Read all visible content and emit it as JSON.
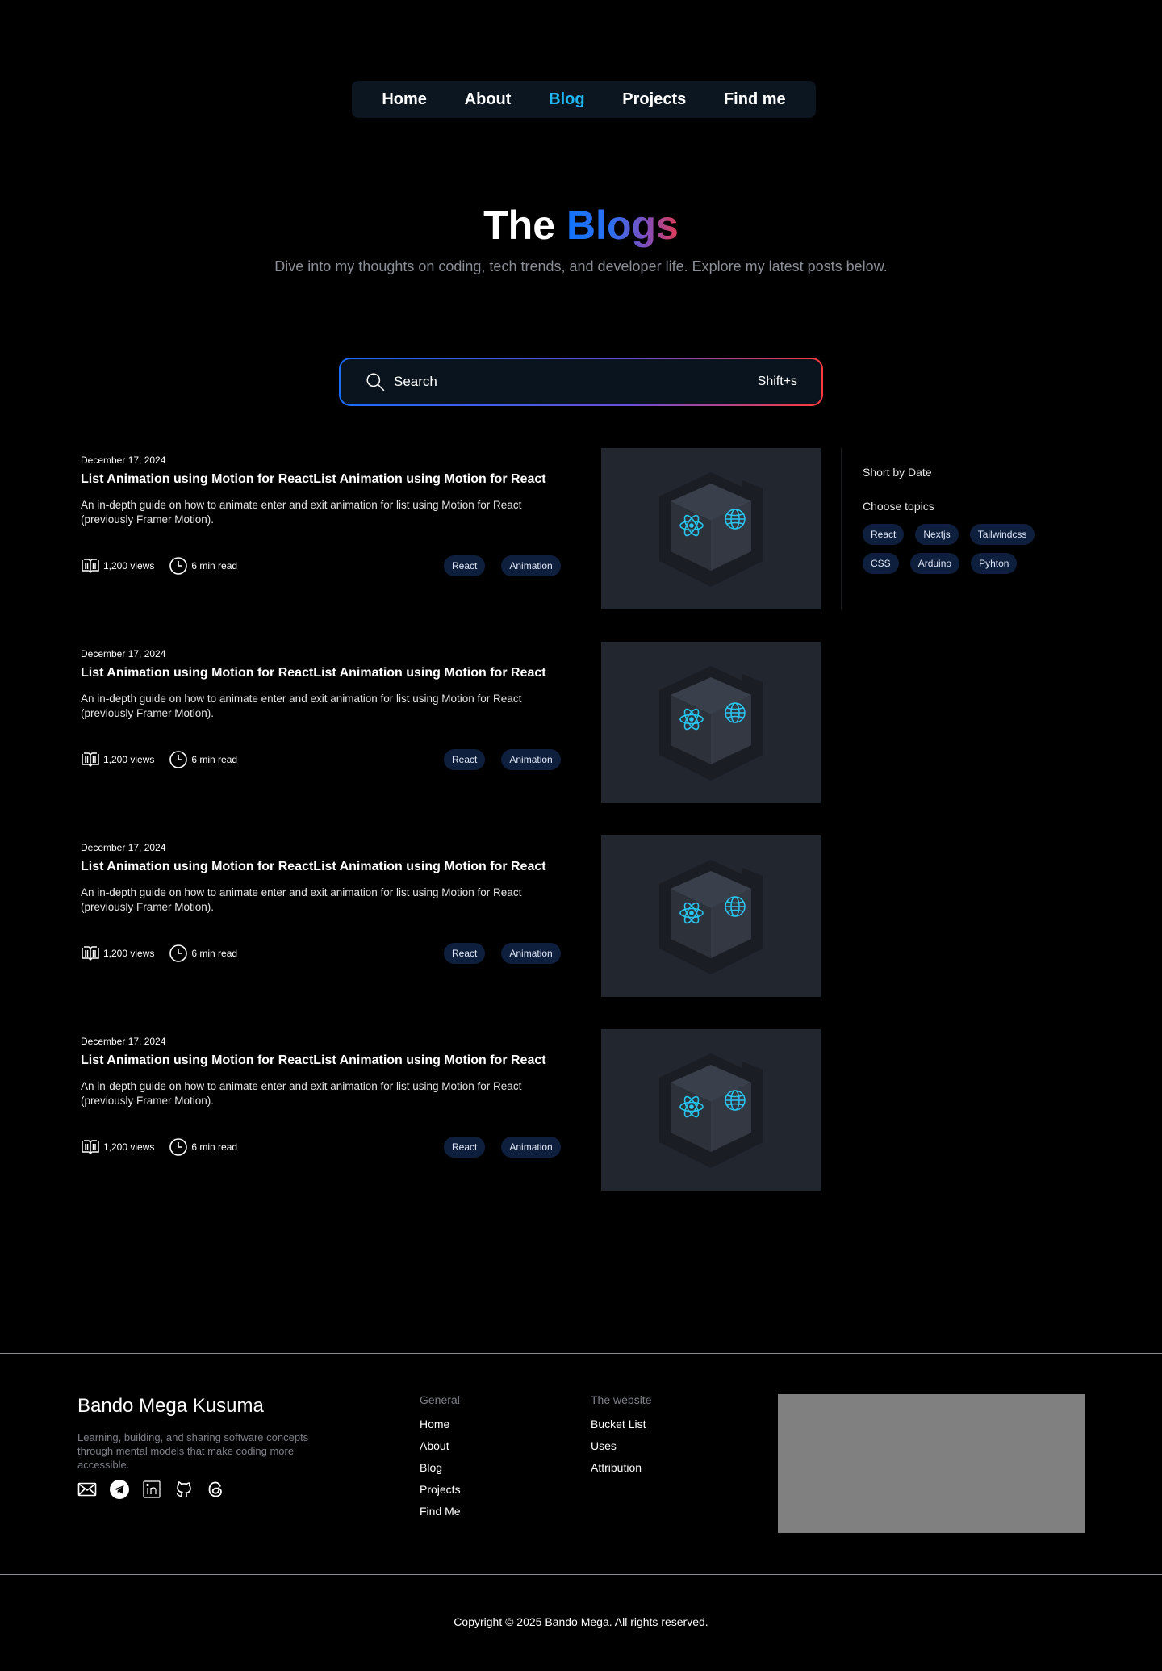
{
  "nav": {
    "items": [
      {
        "label": "Home",
        "active": false
      },
      {
        "label": "About",
        "active": false
      },
      {
        "label": "Blog",
        "active": true
      },
      {
        "label": "Projects",
        "active": false
      },
      {
        "label": "Find me",
        "active": false
      }
    ]
  },
  "hero": {
    "title_plain": "The",
    "title_gradient": "Blogs",
    "subtitle": "Dive into my thoughts on coding, tech trends, and developer life. Explore my latest posts below."
  },
  "search": {
    "placeholder": "Search",
    "shortcut": "Shift+s"
  },
  "posts": [
    {
      "date": "December 17, 2024",
      "title": "List Animation using Motion for ReactList Animation using Motion for React",
      "description": "An in-depth guide on how to animate enter and exit animation for list using Motion for React (previously Framer Motion).",
      "views": "1,200 views",
      "read_time": "6 min read",
      "tags": [
        "React",
        "Animation"
      ]
    },
    {
      "date": "December 17, 2024",
      "title": "List Animation using Motion for ReactList Animation using Motion for React",
      "description": "An in-depth guide on how to animate enter and exit animation for list using Motion for React (previously Framer Motion).",
      "views": "1,200 views",
      "read_time": "6 min read",
      "tags": [
        "React",
        "Animation"
      ]
    },
    {
      "date": "December 17, 2024",
      "title": "List Animation using Motion for ReactList Animation using Motion for React",
      "description": "An in-depth guide on how to animate enter and exit animation for list using Motion for React (previously Framer Motion).",
      "views": "1,200 views",
      "read_time": "6 min read",
      "tags": [
        "React",
        "Animation"
      ]
    },
    {
      "date": "December 17, 2024",
      "title": "List Animation using Motion for ReactList Animation using Motion for React",
      "description": "An in-depth guide on how to animate enter and exit animation for list using Motion for React (previously Framer Motion).",
      "views": "1,200 views",
      "read_time": "6 min read",
      "tags": [
        "React",
        "Animation"
      ]
    }
  ],
  "sidebar": {
    "sort_label": "Short by Date",
    "topics_label": "Choose topics",
    "topics": [
      "React",
      "Nextjs",
      "Tailwindcss",
      "CSS",
      "Arduino",
      "Pyhton"
    ]
  },
  "footer": {
    "name": "Bando Mega Kusuma",
    "description": "Learning, building, and sharing software concepts through mental models that make coding more accessible.",
    "social_icons": [
      "mail-icon",
      "telegram-icon",
      "linkedin-icon",
      "github-icon",
      "threads-icon"
    ],
    "general": {
      "heading": "General",
      "links": [
        "Home",
        "About",
        "Blog",
        "Projects",
        "Find Me"
      ]
    },
    "website": {
      "heading": "The website",
      "links": [
        "Bucket List",
        "Uses",
        "Attribution"
      ]
    },
    "copyright": "Copyright © 2025 Bando Mega. All rights reserved."
  },
  "colors": {
    "accent": "#1fb6f5",
    "tag_bg": "#0e1f3d",
    "thumb_bg": "#22262f"
  }
}
